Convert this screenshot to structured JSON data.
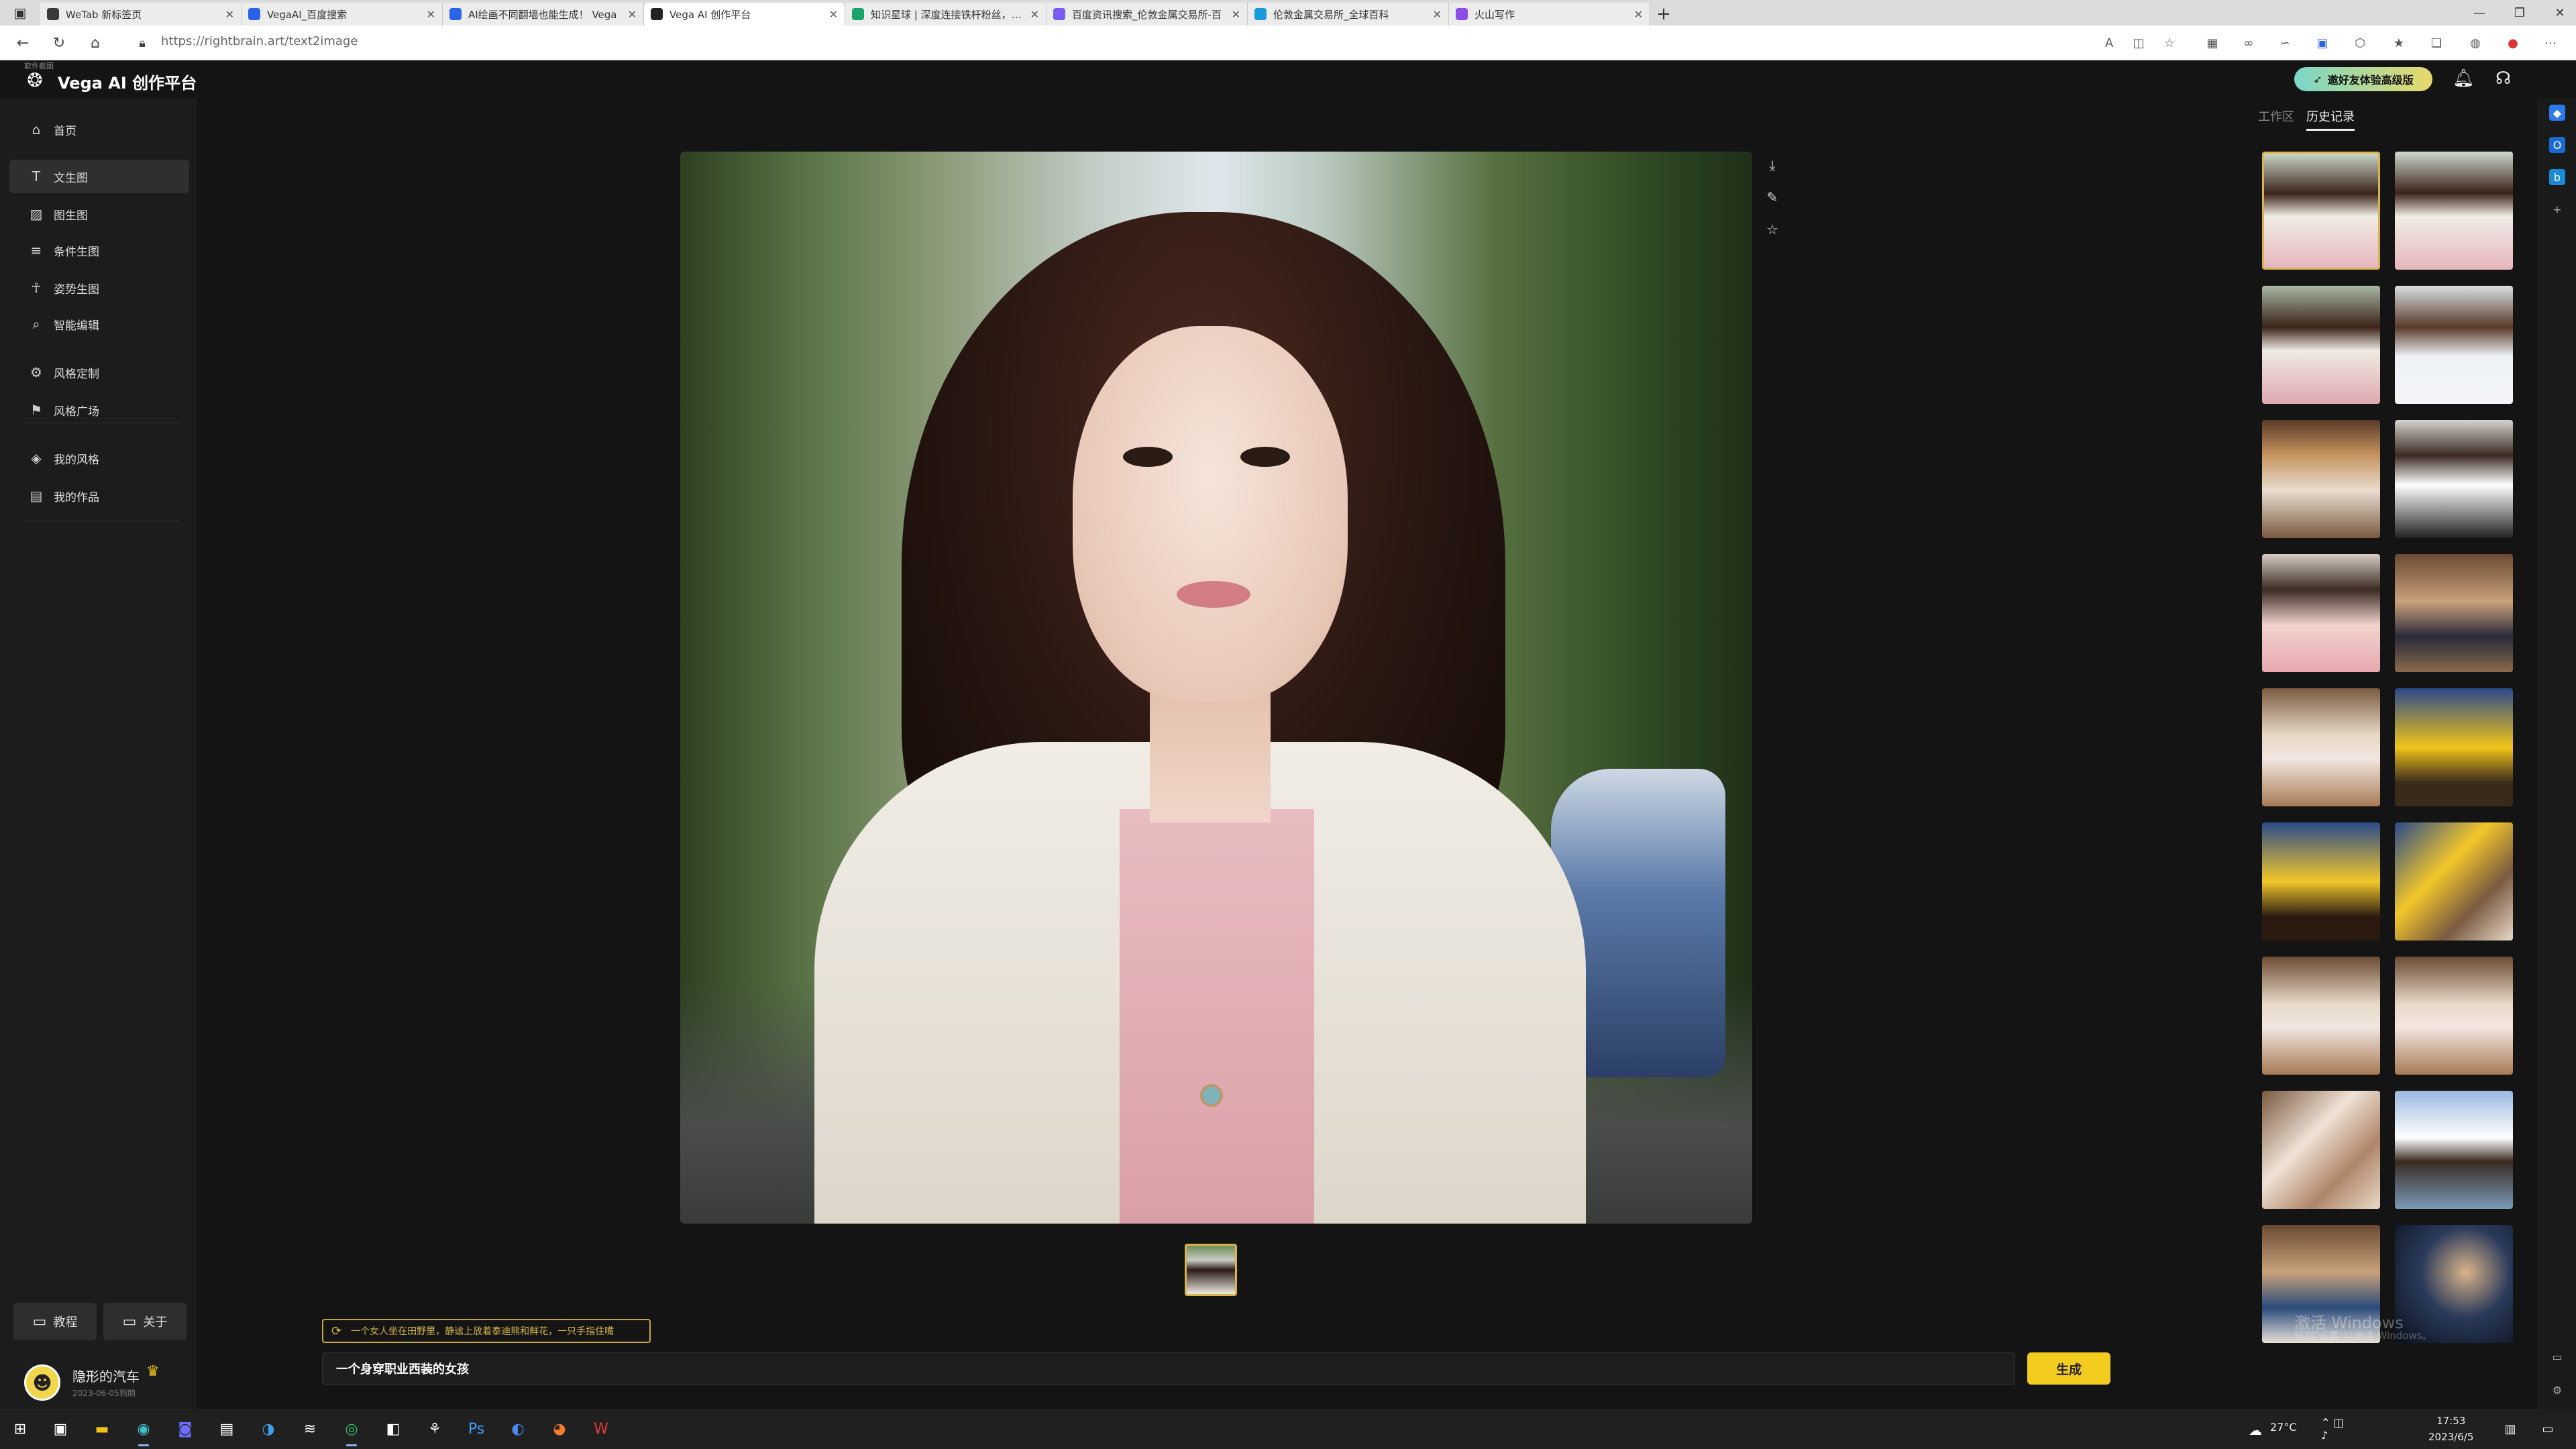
{
  "browser": {
    "tabs": [
      {
        "title": "WeTab 新标签页",
        "color": "#3a3a3a",
        "active": false
      },
      {
        "title": "VegaAI_百度搜索",
        "color": "#2b63e8",
        "active": false
      },
      {
        "title": "AI绘画不同翻墙也能生成！ Vega",
        "color": "#2b63e8",
        "active": false
      },
      {
        "title": "Vega AI 创作平台",
        "color": "#222222",
        "active": true
      },
      {
        "title": "知识星球 | 深度连接铁杆粉丝，运营",
        "color": "#1aa36a",
        "active": false
      },
      {
        "title": "百度资讯搜索_伦敦金属交易所-百",
        "color": "#7a5cf0",
        "active": false
      },
      {
        "title": "伦敦金属交易所_全球百科",
        "color": "#1a9ad6",
        "active": false
      },
      {
        "title": "火山写作",
        "color": "#8a4de8",
        "active": false
      }
    ],
    "url": "https://rightbrain.art/text2image"
  },
  "app": {
    "title": "Vega AI 创作平台",
    "logo_tip": "软件截图",
    "promo": "邀好友体验高级版"
  },
  "sidebar": {
    "items": [
      {
        "label": "首页",
        "icon": "home-icon",
        "glyph": "⌂"
      },
      {
        "label": "文生图",
        "icon": "text-image-icon",
        "glyph": "T"
      },
      {
        "label": "图生图",
        "icon": "image-icon",
        "glyph": "▨"
      },
      {
        "label": "条件生图",
        "icon": "condition-icon",
        "glyph": "≡"
      },
      {
        "label": "姿势生图",
        "icon": "pose-icon",
        "glyph": "☥"
      },
      {
        "label": "智能编辑",
        "icon": "smart-edit-icon",
        "glyph": "⌕"
      },
      {
        "label": "风格定制",
        "icon": "style-custom-icon",
        "glyph": "⚙"
      },
      {
        "label": "风格广场",
        "icon": "style-square-icon",
        "glyph": "⚑"
      },
      {
        "label": "我的风格",
        "icon": "my-style-icon",
        "glyph": "◈"
      },
      {
        "label": "我的作品",
        "icon": "my-works-icon",
        "glyph": "▤"
      }
    ],
    "tutorial": "教程",
    "about": "关于",
    "user": {
      "name": "隐形的汽车",
      "date": "2023-06-05到期"
    }
  },
  "main": {
    "hint": "一个女人坐在田野里，静谧上放着泰迪熊和鲜花，一只手指住嘴",
    "prompt": "一个身穿职业西装的女孩",
    "generate": "生成"
  },
  "right_panel": {
    "tab_work": "工作区",
    "tab_history": "历史记录"
  },
  "taskbar": {
    "temp": "27°C",
    "time": "17:53",
    "date": "2023/6/5"
  },
  "watermark": {
    "line1": "激活 Windows",
    "line2": "转到\"设置\"以激活 Windows。"
  }
}
